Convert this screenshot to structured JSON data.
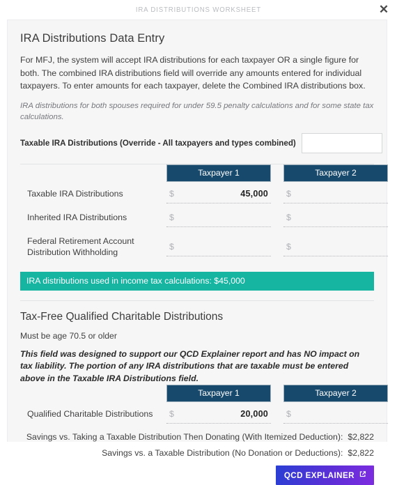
{
  "window": {
    "title": "IRA DISTRIBUTIONS WORKSHEET",
    "close_label": "✕",
    "close_icon": "close-icon"
  },
  "entry_section": {
    "heading": "IRA Distributions Data Entry",
    "paragraph": "For MFJ, the system will accept IRA distributions for each taxpayer OR a single figure for both. The combined IRA distributions field will override any amounts entered for individual taxpayers. To enter amounts for each taxpayer, delete the Combined IRA distributions box.",
    "note": "IRA distributions for both spouses required for under 59.5 penalty calculations and for some state tax calculations.",
    "override": {
      "label": "Taxable IRA Distributions (Override - All taxpayers and types combined)",
      "value": "",
      "placeholder": ""
    },
    "columns": [
      "Taxpayer 1",
      "Taxpayer 2"
    ],
    "currency_symbol": "$",
    "rows": [
      {
        "label": "Taxable IRA Distributions",
        "taxpayer1": "45,000",
        "taxpayer2": ""
      },
      {
        "label": "Inherited IRA Distributions",
        "taxpayer1": "",
        "taxpayer2": ""
      },
      {
        "label": "Federal Retirement Account Distribution Withholding",
        "taxpayer1": "",
        "taxpayer2": ""
      }
    ],
    "banner": "IRA distributions used in income tax calculations: $45,000"
  },
  "qcd_section": {
    "heading": "Tax-Free Qualified Charitable Distributions",
    "age_note": "Must be age 70.5 or older",
    "warning": "This field was designed to support our QCD Explainer report and has NO impact on tax liability. The portion of any IRA distributions that are taxable must be entered above in the Taxable IRA Distributions field.",
    "columns": [
      "Taxpayer 1",
      "Taxpayer 2"
    ],
    "currency_symbol": "$",
    "rows": [
      {
        "label": "Qualified Charitable Distributions",
        "taxpayer1": "20,000",
        "taxpayer2": ""
      }
    ],
    "savings": [
      {
        "label": "Savings vs. Taking a Taxable Distribution Then Donating (With Itemized Deduction):",
        "value": "$2,822"
      },
      {
        "label": "Savings vs. a Taxable Distribution (No Donation or Deductions):",
        "value": "$2,822"
      }
    ],
    "button": {
      "label": "QCD EXPLAINER",
      "icon": "external-link-icon"
    }
  },
  "colors": {
    "header_navy": "#17496d",
    "banner_teal": "#15b5a2",
    "button_gradient_start": "#2a3fd4",
    "button_gradient_end": "#7d2ce0",
    "card_background": "#f6f6f7"
  }
}
